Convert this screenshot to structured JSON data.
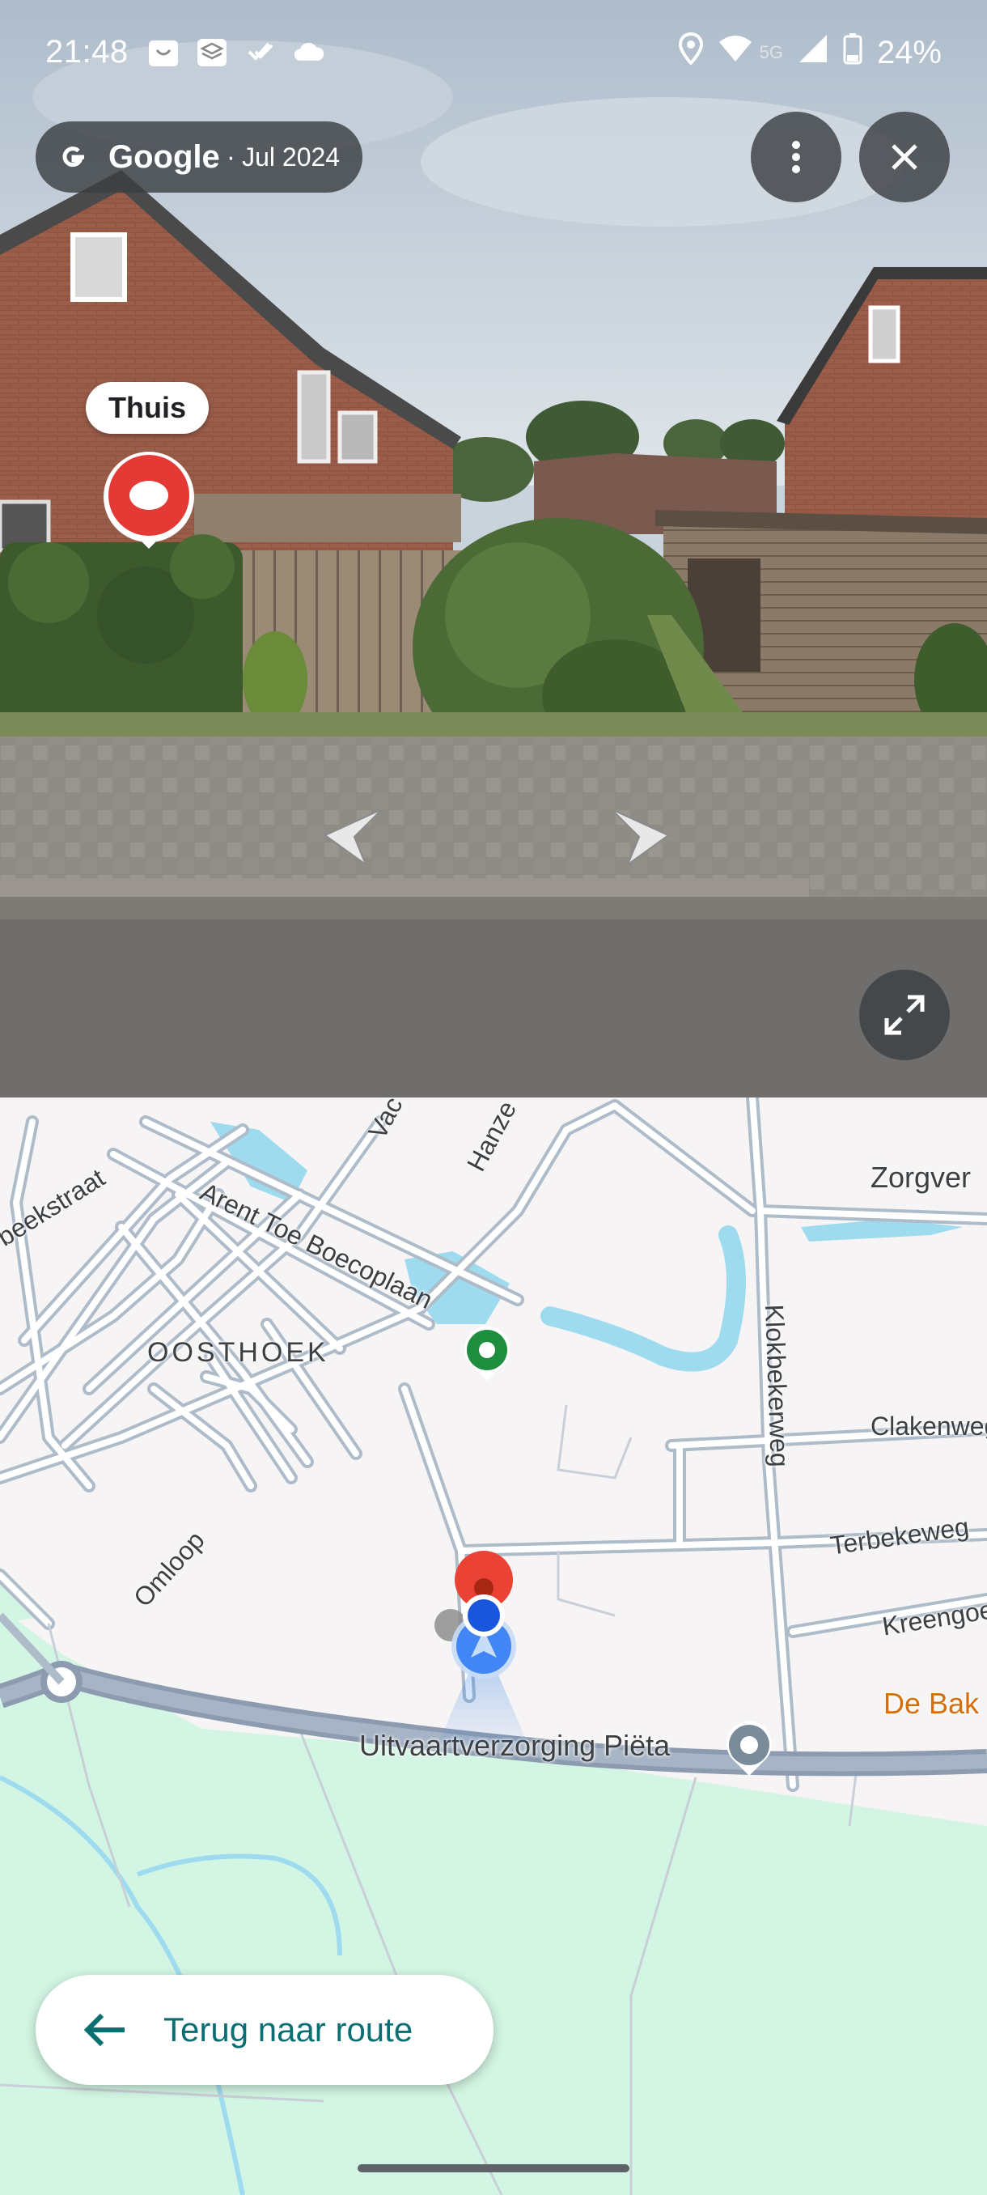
{
  "status_bar": {
    "time": "21:48",
    "network": "5G",
    "battery": "24%",
    "left_icons": [
      "bag-icon",
      "layers-icon",
      "tasks-icon",
      "cloud-icon"
    ],
    "right_icons": [
      "location-icon",
      "wifi-icon",
      "signal-icon",
      "battery-icon"
    ]
  },
  "street_view": {
    "provider": "Google",
    "separator": "·",
    "capture_date": "Jul 2024",
    "place_label": "Thuis",
    "buttons": [
      "more-icon",
      "close-icon",
      "expand-icon"
    ]
  },
  "map": {
    "labels": {
      "arent_toe_boecoplaan": "Arent Toe Boecoplaan",
      "beekstraat": "beekstraat",
      "oosthoek": "OOSTHOEK",
      "omloop": "Omloop",
      "hanze": "Hanze",
      "vac": "Vac",
      "zorgver": "Zorgver",
      "klokbekerweg": "Klokbekerweg",
      "clakenweg": "Clakenweg",
      "terbekeweg": "Terbekeweg",
      "kreengoe": "Kreengoe",
      "de_bak": "De Bak",
      "uitvaart": "Uitvaartverzorging Piëta"
    }
  },
  "back_button": {
    "label": "Terug naar route"
  },
  "colors": {
    "map_bg": "#f6f4f4",
    "park": "#d3f5e3",
    "water": "#9fdbef",
    "road": "#c2cbd6",
    "main_road": "#8c9bb0",
    "accent_teal": "#0b6e72",
    "poi_orange": "#d56e0c",
    "pin_red": "#ea4335",
    "pin_green": "#1e8e3e",
    "location_blue": "#1a73e8"
  }
}
